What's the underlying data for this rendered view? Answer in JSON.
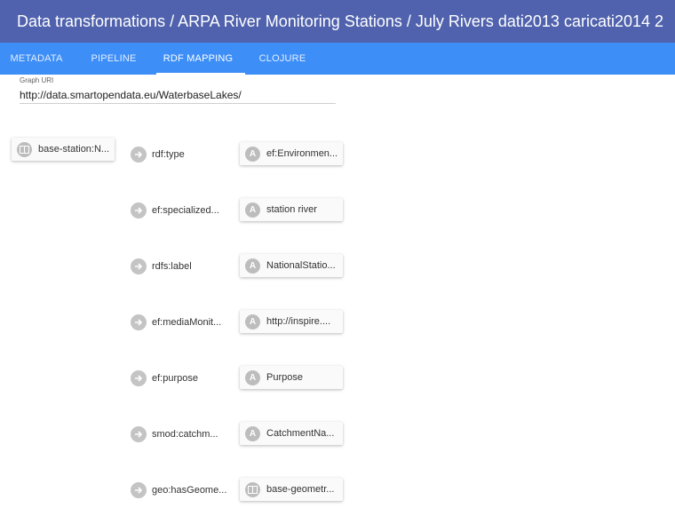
{
  "header": {
    "title": "Data transformations / ARPA River Monitoring Stations / July Rivers dati2013 caricati2014 2"
  },
  "tabs": [
    {
      "label": "METADATA",
      "active": false
    },
    {
      "label": "PIPELINE",
      "active": false
    },
    {
      "label": "RDF MAPPING",
      "active": true
    },
    {
      "label": "CLOJURE",
      "active": false
    }
  ],
  "graph_uri": {
    "label": "Graph URI",
    "value": "http://data.smartopendata.eu/WaterbaseLakes/"
  },
  "subject": {
    "label": "base-station:N...",
    "icon": "column-icon"
  },
  "mappings": [
    {
      "predicate": "rdf:type",
      "object": "ef:Environmen...",
      "object_icon": "literal-icon"
    },
    {
      "predicate": "ef:specialized...",
      "object": "station river",
      "object_icon": "literal-icon"
    },
    {
      "predicate": "rdfs:label",
      "object": "NationalStatio...",
      "object_icon": "literal-icon"
    },
    {
      "predicate": "ef:mediaMonit...",
      "object": "http://inspire....",
      "object_icon": "literal-icon"
    },
    {
      "predicate": "ef:purpose",
      "object": "Purpose",
      "object_icon": "literal-icon"
    },
    {
      "predicate": "smod:catchm...",
      "object": "CatchmentNa...",
      "object_icon": "literal-icon"
    },
    {
      "predicate": "geo:hasGeome...",
      "object": "base-geometr...",
      "object_icon": "column-icon"
    }
  ],
  "colors": {
    "title_bar": "#5062ad",
    "tab_bar": "#3d8ef7",
    "icon_grey": "#c4c4c4"
  }
}
